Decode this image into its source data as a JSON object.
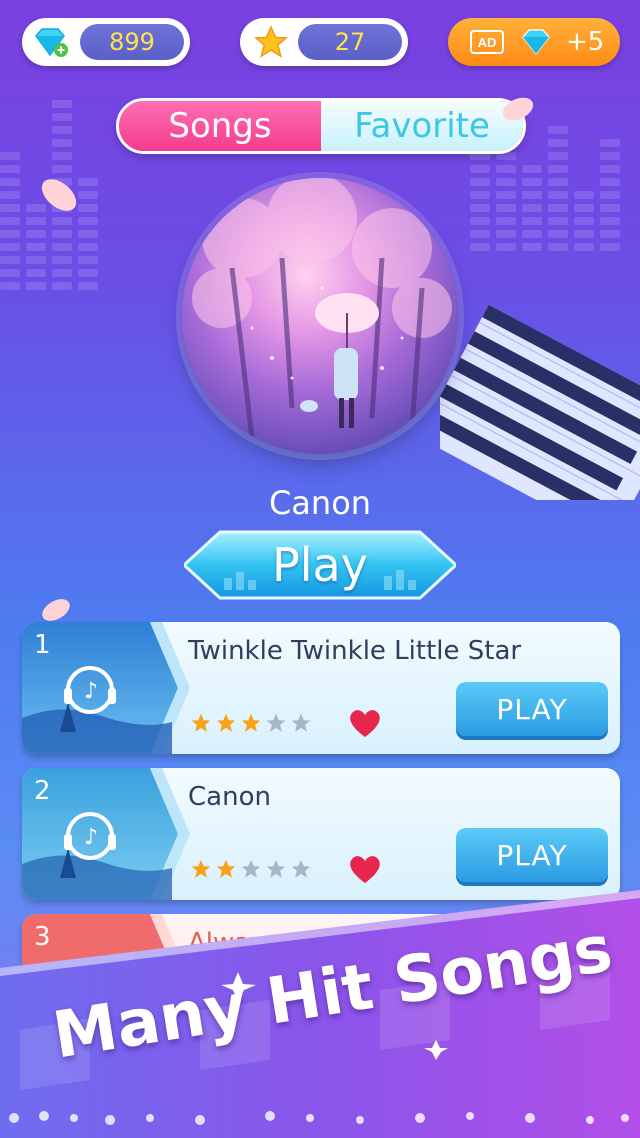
{
  "header": {
    "gems": "899",
    "stars": "27",
    "ad_badge": "AD",
    "ad_reward": "+5"
  },
  "tabs": [
    {
      "label": "Songs",
      "active": true
    },
    {
      "label": "Favorite",
      "active": false
    }
  ],
  "featured": {
    "title": "Canon",
    "play_label": "Play"
  },
  "songs": [
    {
      "num": "1",
      "name": "Twinkle Twinkle Little Star",
      "stars": 3,
      "max_stars": 5,
      "play_label": "PLAY"
    },
    {
      "num": "2",
      "name": "Canon",
      "stars": 2,
      "max_stars": 5,
      "play_label": "PLAY"
    },
    {
      "num": "3",
      "name": "Always wit"
    }
  ],
  "banner": {
    "text": "Many Hit Songs"
  },
  "colors": {
    "accent_pink": "#f23d8d",
    "accent_blue": "#2b9ce3",
    "star_gold": "#f7a21a",
    "heart_red": "#e8264b"
  }
}
